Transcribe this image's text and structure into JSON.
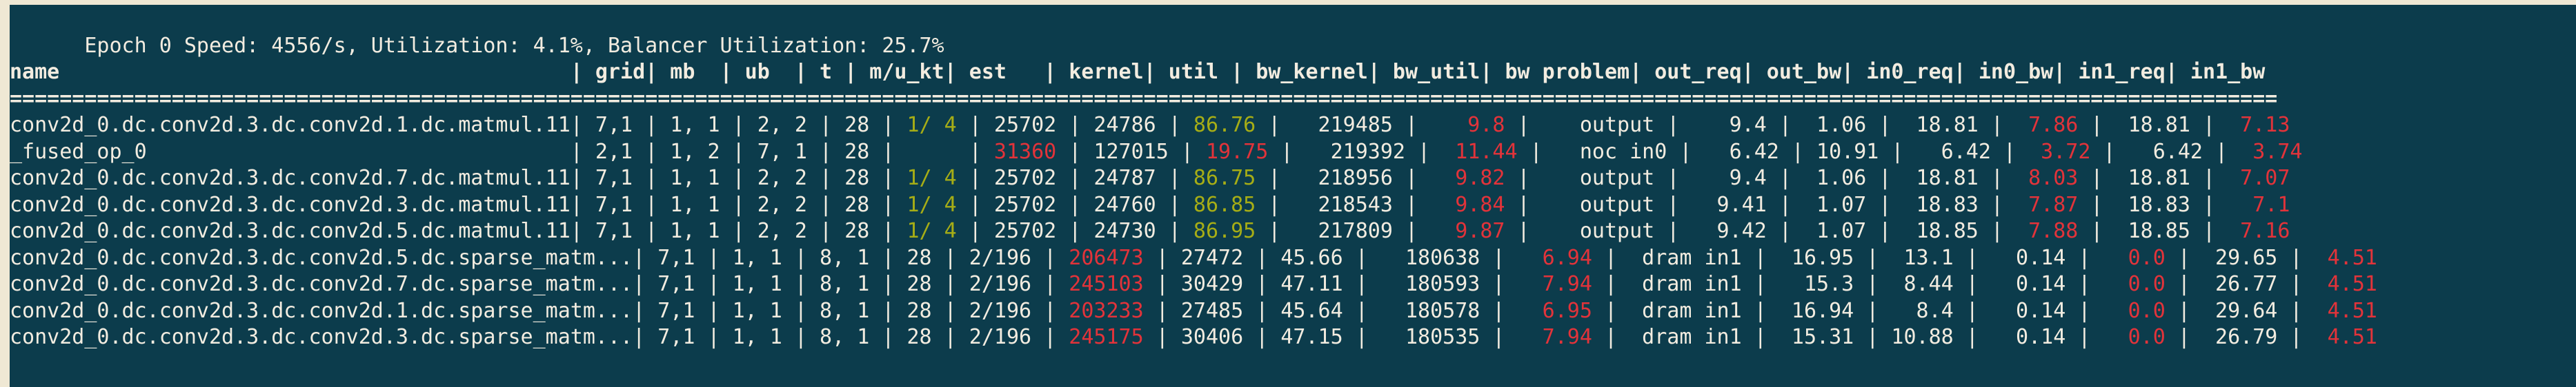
{
  "terminal": {
    "background_color": "#0c3c4c",
    "foreground_color": "#f2ece0",
    "frame_color": "#efe8d4",
    "accent_red": "#e2333a",
    "accent_olive": "#a6ad16"
  },
  "status": {
    "full_text": "Epoch 0 Speed: 4556/s, Utilization: 4.1%, Balancer Utilization: 25.7%",
    "epoch_label": "Epoch",
    "epoch_value": "0",
    "speed_label": "Speed:",
    "speed_value": "4556/s",
    "utilization_label": "Utilization:",
    "utilization_value": "4.1%",
    "balancer_label": "Balancer Utilization:",
    "balancer_value": "25.7%"
  },
  "table": {
    "header_row_text": "name                                           | grid | mb   | ub   | t  | m/u_kt | est    | kernel | util  | bw_kernel | bw_util | bw problem | out_req | out_bw | in0_req | in0_bw | in1_req | in1_bw",
    "separator_char": "=",
    "columns": [
      "name",
      "grid",
      "mb",
      "ub",
      "t",
      "m/u_kt",
      "est",
      "kernel",
      "util",
      "bw_kernel",
      "bw_util",
      "bw problem",
      "out_req",
      "out_bw",
      "in0_req",
      "in0_bw",
      "in1_req",
      "in1_bw"
    ],
    "rows": [
      {
        "name": "conv2d_0.dc.conv2d.3.dc.conv2d.1.dc.matmul.11",
        "grid": "7,1",
        "mb": "1, 1",
        "ub": "2, 2",
        "t": "28",
        "m_u_kt": "1/ 4",
        "m_u_kt_color": "olive",
        "est": "25702",
        "est_color": "white",
        "kernel": "24786",
        "kernel_color": "white",
        "util": "86.76",
        "util_color": "olive",
        "bw_kernel": "219485",
        "bw_kernel_color": "white",
        "bw_util": "9.8",
        "bw_util_color": "red",
        "bw_problem": "output",
        "out_req": "9.4",
        "out_req_color": "white",
        "out_bw": "1.06",
        "out_bw_color": "white",
        "in0_req": "18.81",
        "in0_req_color": "white",
        "in0_bw": "7.86",
        "in0_bw_color": "red",
        "in1_req": "18.81",
        "in1_req_color": "white",
        "in1_bw": "7.13",
        "in1_bw_color": "red"
      },
      {
        "name": "_fused_op_0",
        "grid": "2,1",
        "mb": "1, 2",
        "ub": "7, 1",
        "t": "28",
        "m_u_kt": "",
        "m_u_kt_color": "white",
        "est": "31360",
        "est_color": "red",
        "kernel": "127015",
        "kernel_color": "white",
        "util": "19.75",
        "util_color": "red",
        "bw_kernel": "219392",
        "bw_kernel_color": "white",
        "bw_util": "11.44",
        "bw_util_color": "red",
        "bw_problem": "noc in0",
        "out_req": "6.42",
        "out_req_color": "white",
        "out_bw": "10.91",
        "out_bw_color": "white",
        "in0_req": "6.42",
        "in0_req_color": "white",
        "in0_bw": "3.72",
        "in0_bw_color": "red",
        "in1_req": "6.42",
        "in1_req_color": "white",
        "in1_bw": "3.74",
        "in1_bw_color": "red"
      },
      {
        "name": "conv2d_0.dc.conv2d.3.dc.conv2d.7.dc.matmul.11",
        "grid": "7,1",
        "mb": "1, 1",
        "ub": "2, 2",
        "t": "28",
        "m_u_kt": "1/ 4",
        "m_u_kt_color": "olive",
        "est": "25702",
        "est_color": "white",
        "kernel": "24787",
        "kernel_color": "white",
        "util": "86.75",
        "util_color": "olive",
        "bw_kernel": "218956",
        "bw_kernel_color": "white",
        "bw_util": "9.82",
        "bw_util_color": "red",
        "bw_problem": "output",
        "out_req": "9.4",
        "out_req_color": "white",
        "out_bw": "1.06",
        "out_bw_color": "white",
        "in0_req": "18.81",
        "in0_req_color": "white",
        "in0_bw": "8.03",
        "in0_bw_color": "red",
        "in1_req": "18.81",
        "in1_req_color": "white",
        "in1_bw": "7.07",
        "in1_bw_color": "red"
      },
      {
        "name": "conv2d_0.dc.conv2d.3.dc.conv2d.3.dc.matmul.11",
        "grid": "7,1",
        "mb": "1, 1",
        "ub": "2, 2",
        "t": "28",
        "m_u_kt": "1/ 4",
        "m_u_kt_color": "olive",
        "est": "25702",
        "est_color": "white",
        "kernel": "24760",
        "kernel_color": "white",
        "util": "86.85",
        "util_color": "olive",
        "bw_kernel": "218543",
        "bw_kernel_color": "white",
        "bw_util": "9.84",
        "bw_util_color": "red",
        "bw_problem": "output",
        "out_req": "9.41",
        "out_req_color": "white",
        "out_bw": "1.07",
        "out_bw_color": "white",
        "in0_req": "18.83",
        "in0_req_color": "white",
        "in0_bw": "7.87",
        "in0_bw_color": "red",
        "in1_req": "18.83",
        "in1_req_color": "white",
        "in1_bw": "7.1",
        "in1_bw_color": "red"
      },
      {
        "name": "conv2d_0.dc.conv2d.3.dc.conv2d.5.dc.matmul.11",
        "grid": "7,1",
        "mb": "1, 1",
        "ub": "2, 2",
        "t": "28",
        "m_u_kt": "1/ 4",
        "m_u_kt_color": "olive",
        "est": "25702",
        "est_color": "white",
        "kernel": "24730",
        "kernel_color": "white",
        "util": "86.95",
        "util_color": "olive",
        "bw_kernel": "217809",
        "bw_kernel_color": "white",
        "bw_util": "9.87",
        "bw_util_color": "red",
        "bw_problem": "output",
        "out_req": "9.42",
        "out_req_color": "white",
        "out_bw": "1.07",
        "out_bw_color": "white",
        "in0_req": "18.85",
        "in0_req_color": "white",
        "in0_bw": "7.88",
        "in0_bw_color": "red",
        "in1_req": "18.85",
        "in1_req_color": "white",
        "in1_bw": "7.16",
        "in1_bw_color": "red"
      },
      {
        "name": "conv2d_0.dc.conv2d.3.dc.conv2d.5.dc.sparse_matm...",
        "grid": "7,1",
        "mb": "1, 1",
        "ub": "8, 1",
        "t": "28",
        "m_u_kt": "2/196",
        "m_u_kt_color": "white",
        "est": "206473",
        "est_color": "red",
        "kernel": "27472",
        "kernel_color": "white",
        "util": "45.66",
        "util_color": "white",
        "bw_kernel": "180638",
        "bw_kernel_color": "white",
        "bw_util": "6.94",
        "bw_util_color": "red",
        "bw_problem": "dram in1",
        "out_req": "16.95",
        "out_req_color": "white",
        "out_bw": "13.1",
        "out_bw_color": "white",
        "in0_req": "0.14",
        "in0_req_color": "white",
        "in0_bw": "0.0",
        "in0_bw_color": "red",
        "in1_req": "29.65",
        "in1_req_color": "white",
        "in1_bw": "4.51",
        "in1_bw_color": "red"
      },
      {
        "name": "conv2d_0.dc.conv2d.3.dc.conv2d.7.dc.sparse_matm...",
        "grid": "7,1",
        "mb": "1, 1",
        "ub": "8, 1",
        "t": "28",
        "m_u_kt": "2/196",
        "m_u_kt_color": "white",
        "est": "245103",
        "est_color": "red",
        "kernel": "30429",
        "kernel_color": "white",
        "util": "47.11",
        "util_color": "white",
        "bw_kernel": "180593",
        "bw_kernel_color": "white",
        "bw_util": "7.94",
        "bw_util_color": "red",
        "bw_problem": "dram in1",
        "out_req": "15.3",
        "out_req_color": "white",
        "out_bw": "8.44",
        "out_bw_color": "white",
        "in0_req": "0.14",
        "in0_req_color": "white",
        "in0_bw": "0.0",
        "in0_bw_color": "red",
        "in1_req": "26.77",
        "in1_req_color": "white",
        "in1_bw": "4.51",
        "in1_bw_color": "red"
      },
      {
        "name": "conv2d_0.dc.conv2d.3.dc.conv2d.1.dc.sparse_matm...",
        "grid": "7,1",
        "mb": "1, 1",
        "ub": "8, 1",
        "t": "28",
        "m_u_kt": "2/196",
        "m_u_kt_color": "white",
        "est": "203233",
        "est_color": "red",
        "kernel": "27485",
        "kernel_color": "white",
        "util": "45.64",
        "util_color": "white",
        "bw_kernel": "180578",
        "bw_kernel_color": "white",
        "bw_util": "6.95",
        "bw_util_color": "red",
        "bw_problem": "dram in1",
        "out_req": "16.94",
        "out_req_color": "white",
        "out_bw": "8.4",
        "out_bw_color": "white",
        "in0_req": "0.14",
        "in0_req_color": "white",
        "in0_bw": "0.0",
        "in0_bw_color": "red",
        "in1_req": "29.64",
        "in1_req_color": "white",
        "in1_bw": "4.51",
        "in1_bw_color": "red"
      },
      {
        "name": "conv2d_0.dc.conv2d.3.dc.conv2d.3.dc.sparse_matm...",
        "grid": "7,1",
        "mb": "1, 1",
        "ub": "8, 1",
        "t": "28",
        "m_u_kt": "2/196",
        "m_u_kt_color": "white",
        "est": "245175",
        "est_color": "red",
        "kernel": "30406",
        "kernel_color": "white",
        "util": "47.15",
        "util_color": "white",
        "bw_kernel": "180535",
        "bw_kernel_color": "white",
        "bw_util": "7.94",
        "bw_util_color": "red",
        "bw_problem": "dram in1",
        "out_req": "15.31",
        "out_req_color": "white",
        "out_bw": "10.88",
        "out_bw_color": "white",
        "in0_req": "0.14",
        "in0_req_color": "white",
        "in0_bw": "0.0",
        "in0_bw_color": "red",
        "in1_req": "26.79",
        "in1_req_color": "white",
        "in1_bw": "4.51",
        "in1_bw_color": "red"
      }
    ]
  }
}
